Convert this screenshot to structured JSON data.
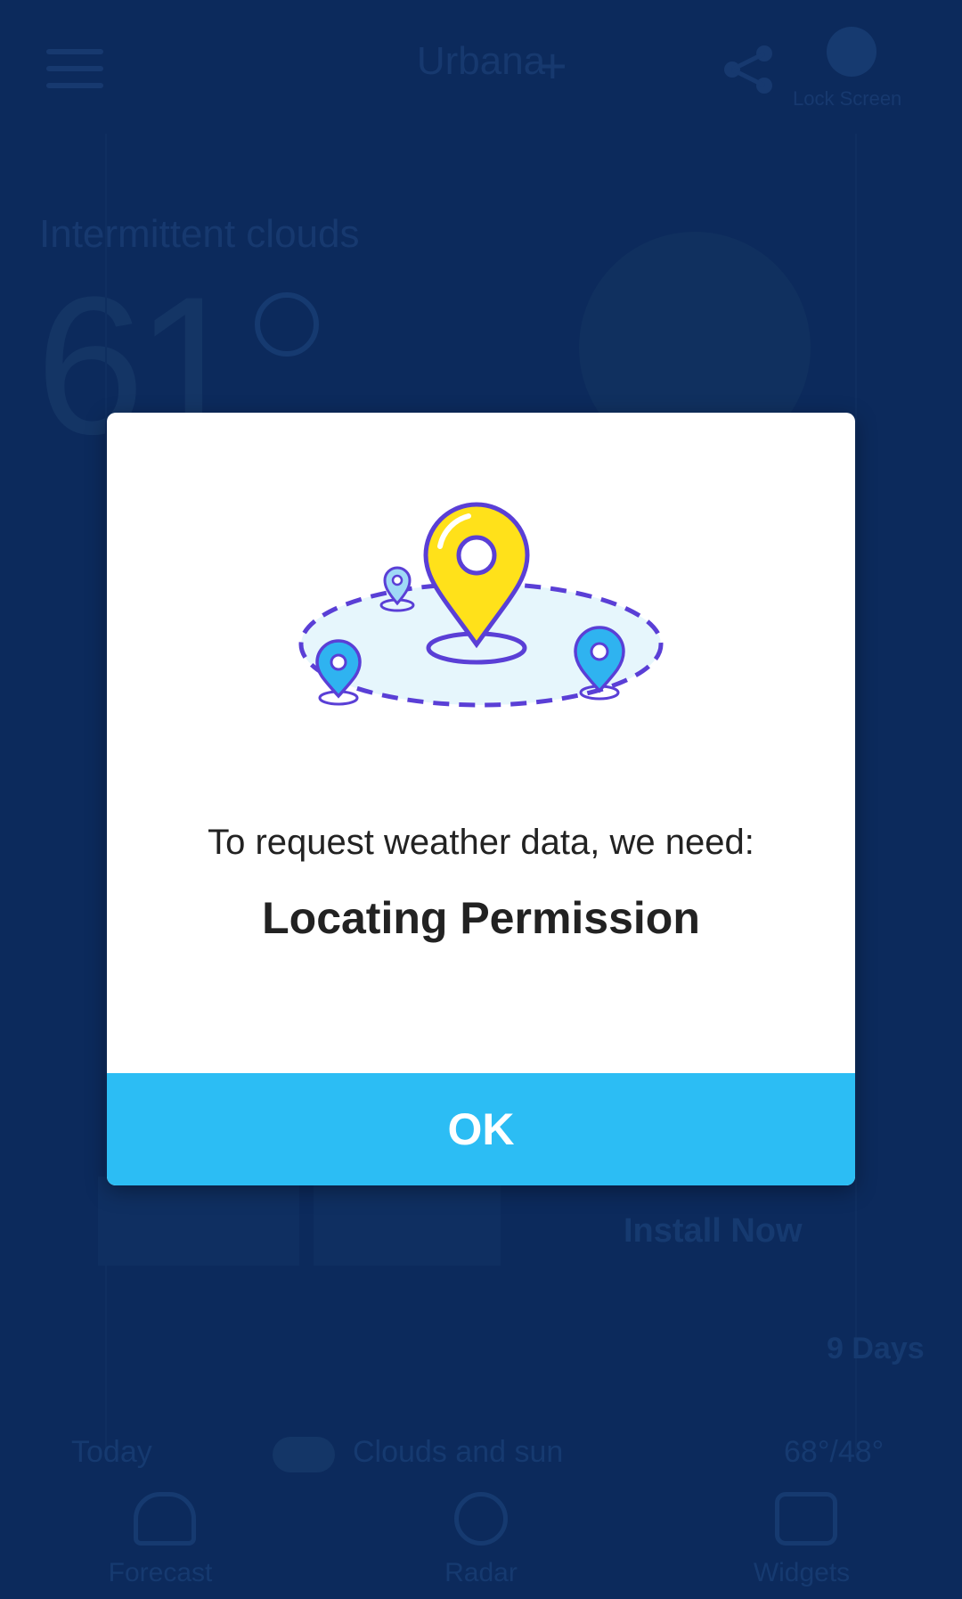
{
  "background": {
    "city": "Urbana",
    "lock_screen_label": "Lock Screen",
    "condition": "Intermittent clouds",
    "temperature": "61",
    "install_label": "Install Now",
    "days_label": "9 Days",
    "forecast_row": {
      "day": "Today",
      "condition": "Clouds and sun",
      "temps": "68°/48°"
    },
    "nav": {
      "forecast": "Forecast",
      "radar": "Radar",
      "widgets": "Widgets"
    }
  },
  "dialog": {
    "prompt": "To request weather data, we need:",
    "permission": "Locating Permission",
    "ok_label": "OK"
  },
  "colors": {
    "backdrop": "#0c2a5c",
    "ok_button": "#2cbdf4",
    "pin_main": "#ffe11a",
    "pin_small": "#2fb3f0",
    "outline": "#5a3fd6"
  }
}
